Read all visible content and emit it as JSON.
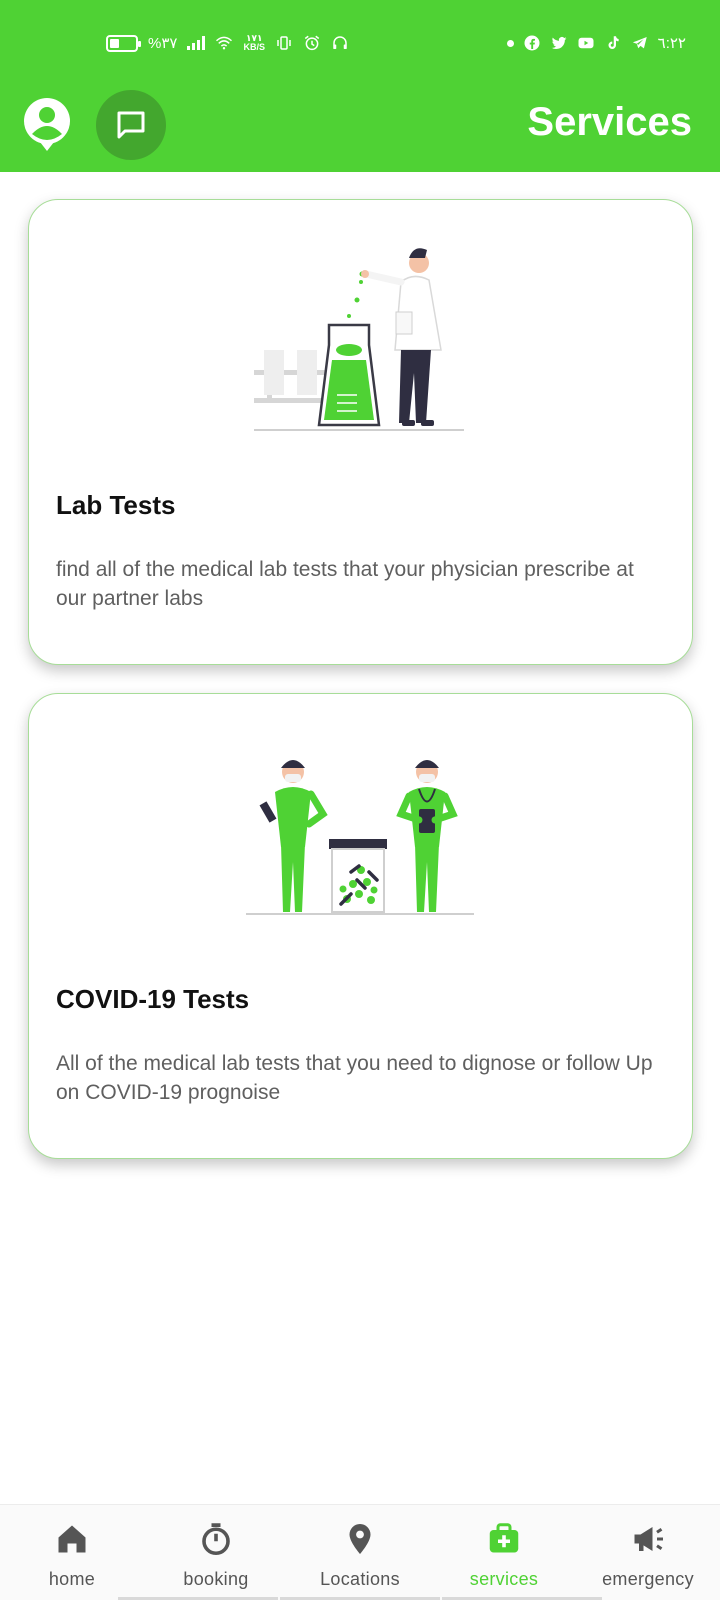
{
  "status_bar": {
    "battery_text": "%۳۷",
    "speed_value": "۱۷۱",
    "speed_unit": "KB/S",
    "time": "٦:٢٢",
    "battery_level": 0.37
  },
  "header": {
    "title": "Services",
    "avatar_icon": "account-circle-icon",
    "chat_icon": "chat-bubble-icon"
  },
  "cards": [
    {
      "title": "Lab Tests",
      "description": "find all of the medical lab tests that your physician prescribe at our partner labs",
      "image": "lab-scientist-illustration"
    },
    {
      "title": "COVID-19 Tests",
      "description": "All of the medical lab tests that you need to dignose or follow Up on COVID-19 prognoise",
      "image": "nurses-medicine-jar-illustration"
    }
  ],
  "bottom_nav": {
    "items": [
      {
        "label": "home",
        "icon": "home-icon"
      },
      {
        "label": "booking",
        "icon": "timer-icon"
      },
      {
        "label": "Locations",
        "icon": "location-pin-icon"
      },
      {
        "label": "services",
        "icon": "medical-kit-icon"
      },
      {
        "label": "emergency",
        "icon": "megaphone-icon"
      }
    ],
    "active_index": 3
  },
  "colors": {
    "primary": "#4fd234",
    "primary_dark": "#43a72e",
    "card_border": "#a7dd98",
    "inactive": "#555555"
  }
}
